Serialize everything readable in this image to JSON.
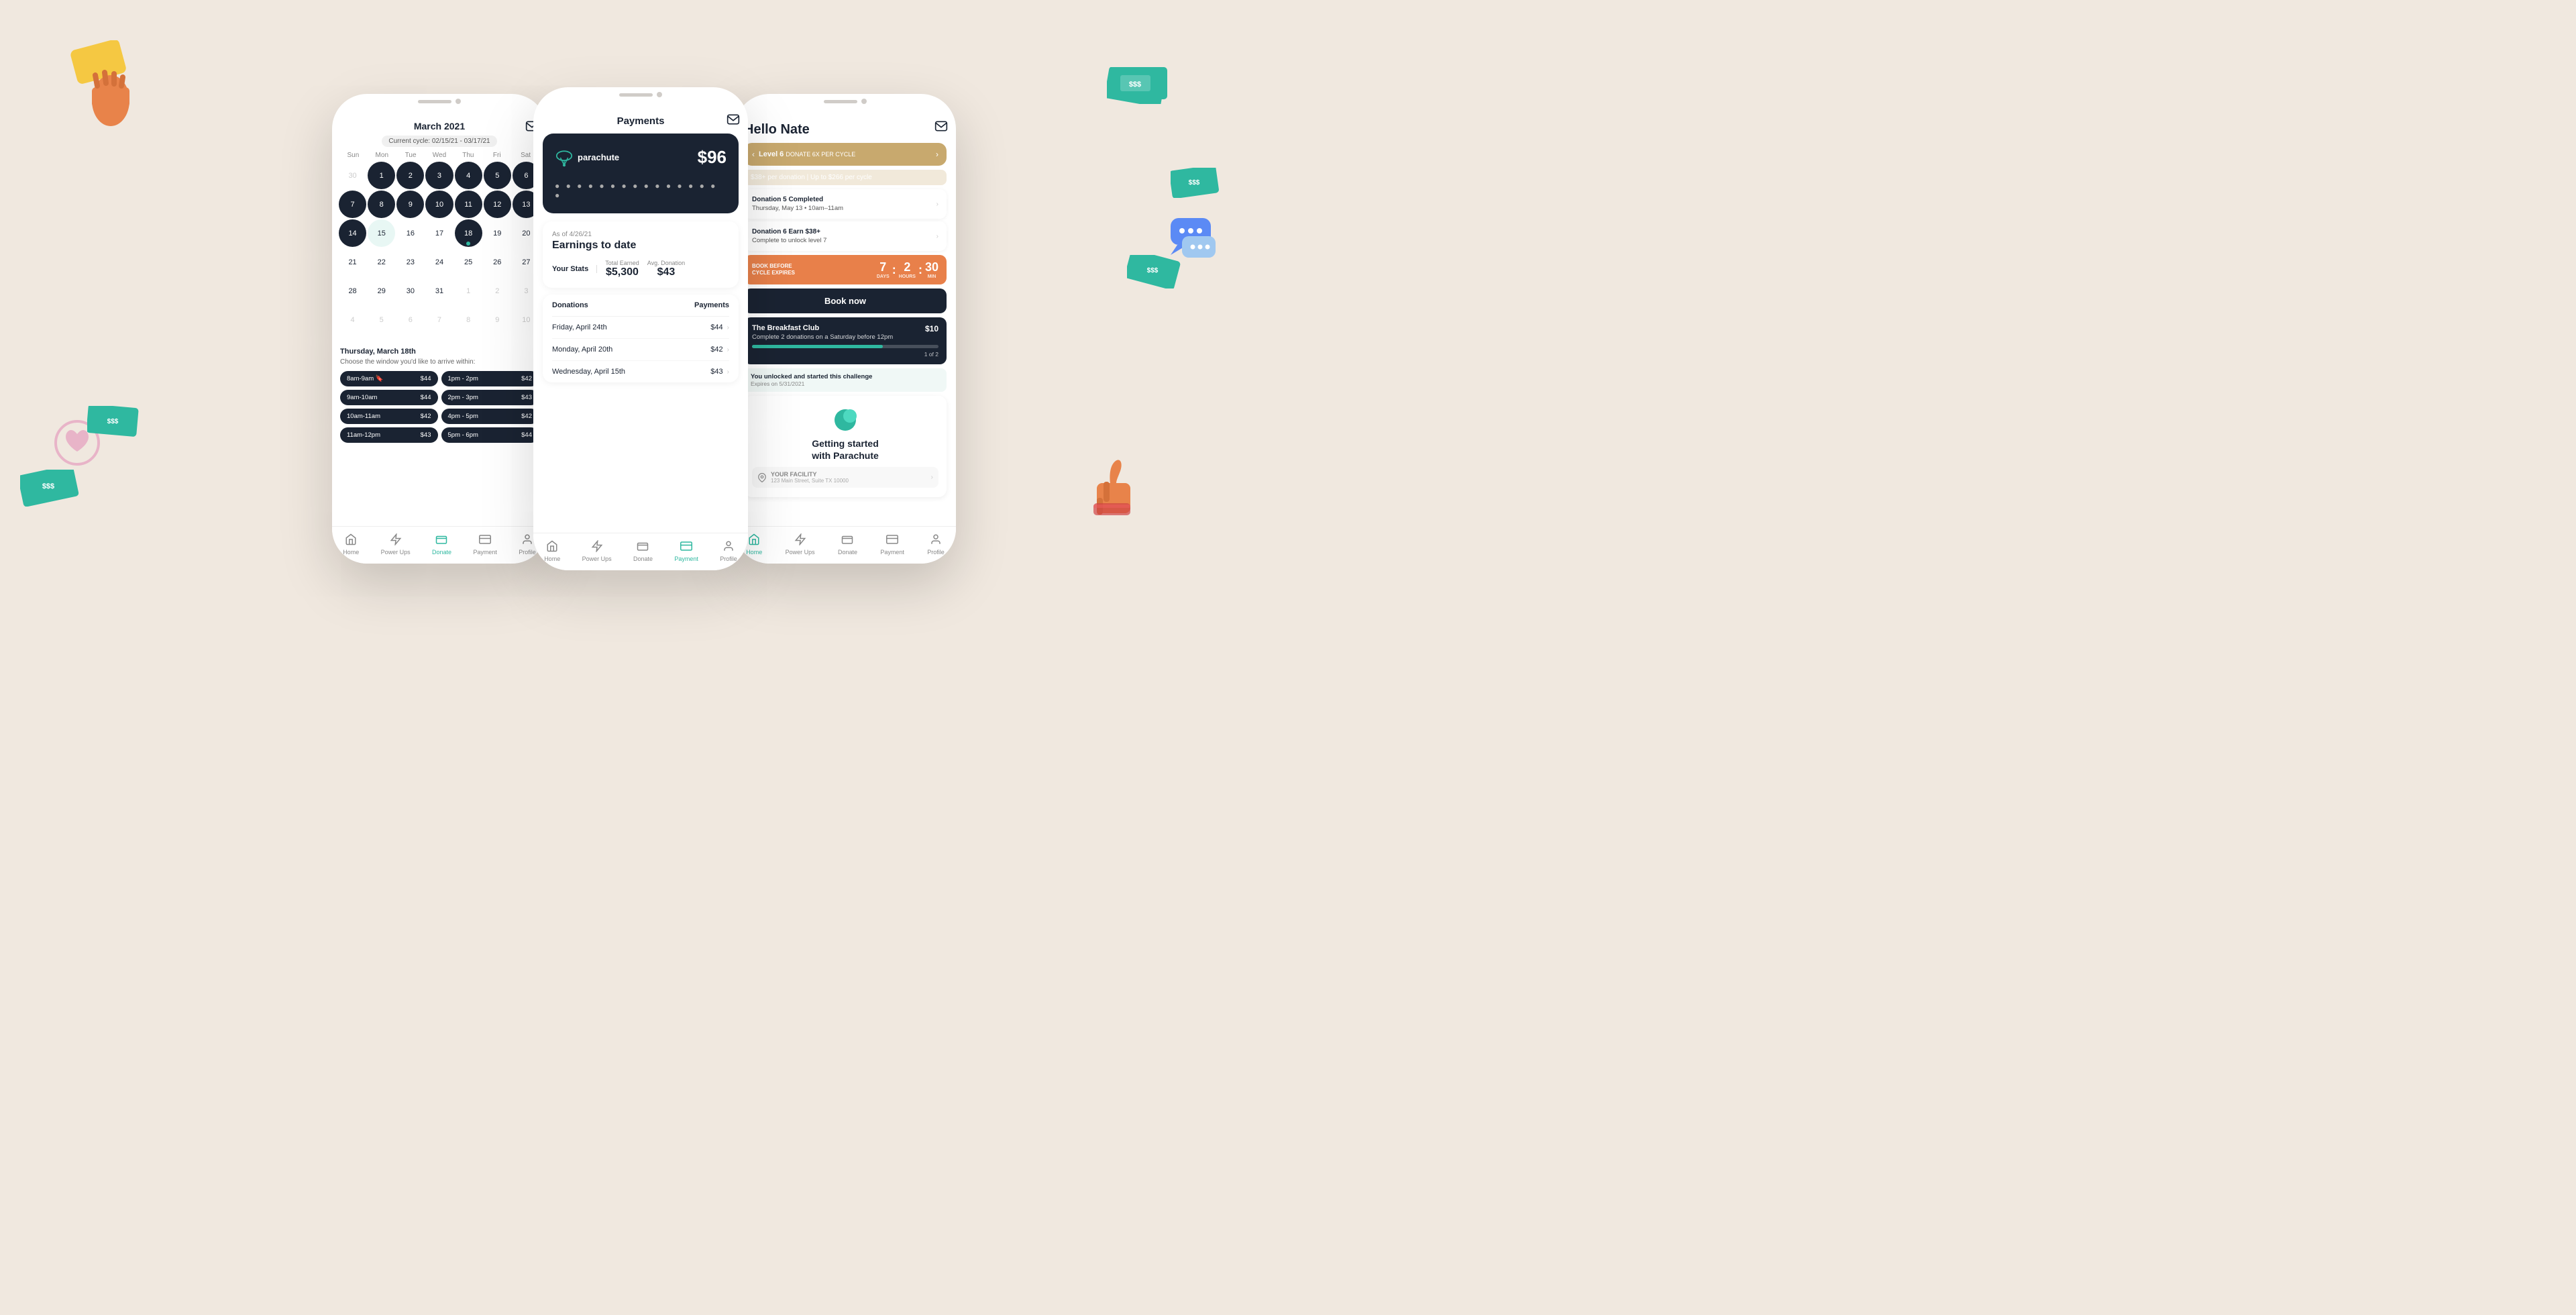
{
  "background_color": "#f0e8df",
  "phone1": {
    "title": "March 2021",
    "cycle": "Current cycle: 02/15/21 - 03/17/21",
    "days_header": [
      "Sun",
      "Mon",
      "Tue",
      "Wed",
      "Thu",
      "Fri",
      "Sat"
    ],
    "calendar": [
      [
        "30",
        "1",
        "2",
        "3",
        "4",
        "5",
        "6"
      ],
      [
        "7",
        "8",
        "9",
        "10",
        "11",
        "12",
        "13"
      ],
      [
        "14",
        "15",
        "16",
        "17",
        "18",
        "19",
        "20"
      ],
      [
        "21",
        "22",
        "23",
        "24",
        "25",
        "26",
        "27"
      ],
      [
        "28",
        "29",
        "30",
        "31",
        "1",
        "2",
        "3"
      ],
      [
        "4",
        "5",
        "6",
        "7",
        "8",
        "9",
        "10"
      ]
    ],
    "event_day": "Thursday, March 18th",
    "event_sub": "Choose the window you'd like to arrive within:",
    "time_slots": [
      {
        "time": "8am-9am",
        "price": "$44",
        "icon": "🔖"
      },
      {
        "time": "1pm - 2pm",
        "price": "$42"
      },
      {
        "time": "9am-10am",
        "price": "$44"
      },
      {
        "time": "2pm - 3pm",
        "price": "$43"
      },
      {
        "time": "10am-11am",
        "price": "$42"
      },
      {
        "time": "4pm - 5pm",
        "price": "$42"
      },
      {
        "time": "11am-12pm",
        "price": "$43"
      },
      {
        "time": "5pm - 6pm",
        "price": "$44"
      }
    ],
    "nav": [
      "Home",
      "Power Ups",
      "Donate",
      "Payment",
      "Profile"
    ],
    "active_nav": "Donate"
  },
  "phone2": {
    "title": "Payments",
    "card_amount": "$96",
    "card_logo": "parachute",
    "card_dots": "● ● ● ●   ● ● ● ●   ● ● ● ●   ● ● ● ●",
    "earnings_date": "As of 4/26/21",
    "earnings_title": "Earnings to date",
    "stats_label": "Your Stats",
    "total_earned_label": "Total Earned",
    "total_earned": "$5,300",
    "avg_donation_label": "Avg. Donation",
    "avg_donation": "$43",
    "donations_label": "Donations",
    "payments_label": "Payments",
    "donations": [
      {
        "date": "Friday, April 24th",
        "amount": "$44"
      },
      {
        "date": "Monday, April 20th",
        "amount": "$42"
      },
      {
        "date": "Wednesday, April 15th",
        "amount": "$43"
      }
    ],
    "nav": [
      "Home",
      "Power Ups",
      "Donate",
      "Payment",
      "Profile"
    ],
    "active_nav": "Payment"
  },
  "phone3": {
    "greeting": "Hello Nate",
    "level": "Level 6",
    "level_sub": "DONATE 6X PER CYCLE",
    "level_detail": "$38+ per donation | Up to $266 per cycle",
    "donation5_title": "Donation 5 Completed",
    "donation5_date": "Thursday, May 13 • 10am–11am",
    "donation6_title": "Donation 6 Earn $38+",
    "donation6_sub": "Complete to unlock level 7",
    "timer_label": "BOOK BEFORE\nCYCLE EXPIRES",
    "timer_days": "7",
    "timer_hours": "2",
    "timer_mins": "30",
    "timer_days_label": "DAYS",
    "timer_hours_label": "HOURS",
    "timer_mins_label": "MIN",
    "book_btn": "Book now",
    "challenge_title": "The Breakfast Club",
    "challenge_amount": "$10",
    "challenge_sub": "Complete 2 donations on a Saturday before 12pm",
    "challenge_progress": "1 of 2",
    "unlock_title": "You unlocked and started this challenge",
    "unlock_sub": "Expires on 5/31/2021",
    "gs_title": "Getting started\nwith Parachute",
    "gs_facility": "YOUR FACILITY",
    "gs_address": "123 Main Street, Suite TX 10000",
    "nav": [
      "Home",
      "Power Ups",
      "Donate",
      "Payment",
      "Profile"
    ],
    "active_nav": "Home"
  }
}
